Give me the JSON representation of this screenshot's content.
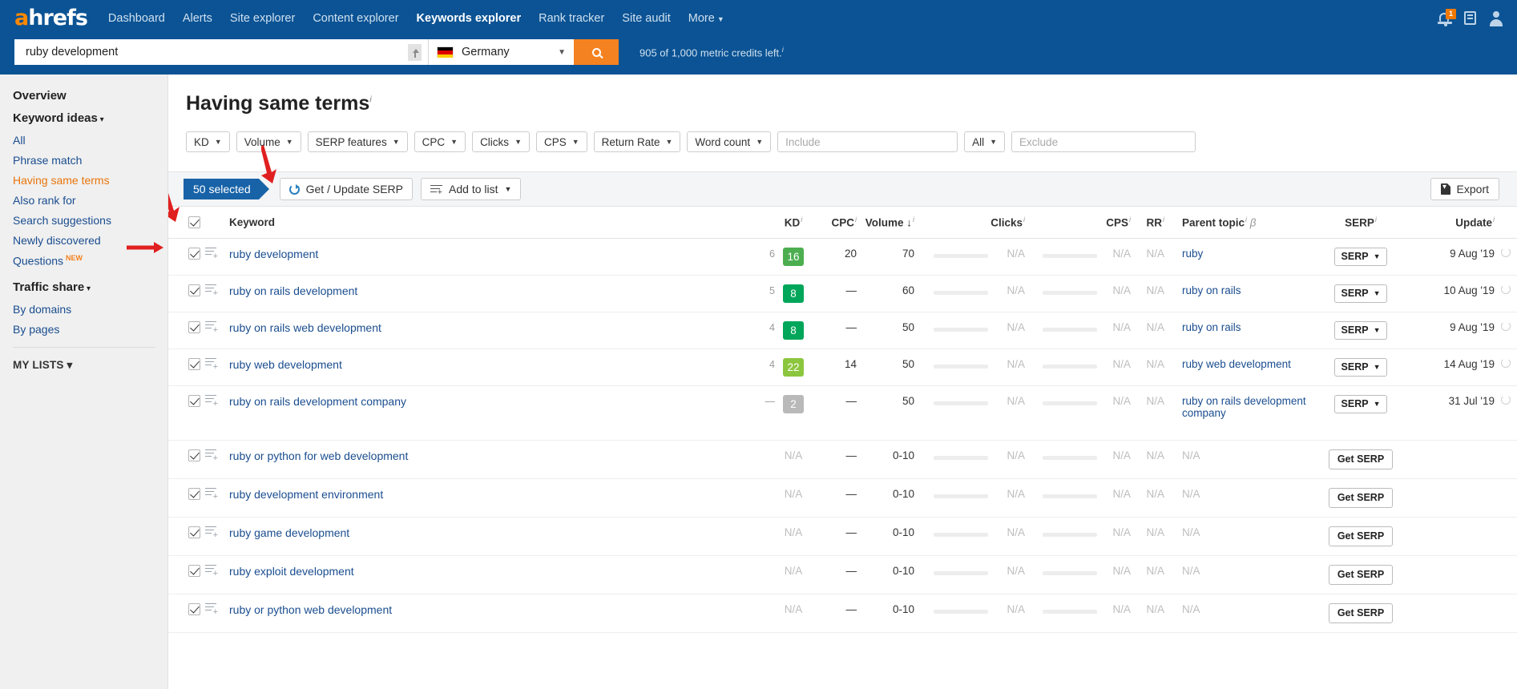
{
  "nav": {
    "logo": "ahrefs",
    "items": [
      {
        "label": "Dashboard",
        "active": false
      },
      {
        "label": "Alerts",
        "active": false
      },
      {
        "label": "Site explorer",
        "active": false
      },
      {
        "label": "Content explorer",
        "active": false
      },
      {
        "label": "Keywords explorer",
        "active": true
      },
      {
        "label": "Rank tracker",
        "active": false
      },
      {
        "label": "Site audit",
        "active": false
      },
      {
        "label": "More",
        "active": false,
        "caret": true
      }
    ],
    "notification_count": "1"
  },
  "search": {
    "value": "ruby development",
    "country": "Germany",
    "credits": "905 of 1,000 metric credits left."
  },
  "sidebar": {
    "overview": "Overview",
    "keyword_ideas": "Keyword ideas",
    "keyword_ideas_items": [
      {
        "label": "All",
        "active": false
      },
      {
        "label": "Phrase match",
        "active": false
      },
      {
        "label": "Having same terms",
        "active": true
      },
      {
        "label": "Also rank for",
        "active": false
      },
      {
        "label": "Search suggestions",
        "active": false
      },
      {
        "label": "Newly discovered",
        "active": false
      },
      {
        "label": "Questions",
        "active": false,
        "badge": "NEW"
      }
    ],
    "traffic_share": "Traffic share",
    "traffic_share_items": [
      {
        "label": "By domains"
      },
      {
        "label": "By pages"
      }
    ],
    "my_lists": "MY LISTS"
  },
  "page": {
    "title": "Having same terms"
  },
  "filters": [
    {
      "label": "KD"
    },
    {
      "label": "Volume"
    },
    {
      "label": "SERP features"
    },
    {
      "label": "CPC"
    },
    {
      "label": "Clicks"
    },
    {
      "label": "CPS"
    },
    {
      "label": "Return Rate"
    },
    {
      "label": "Word count"
    }
  ],
  "include_placeholder": "Include",
  "include_value": "",
  "all_dropdown": "All",
  "exclude_placeholder": "Exclude",
  "exclude_value": "",
  "toolbar": {
    "selected": "50 selected",
    "get_update_serp": "Get / Update SERP",
    "add_to_list": "Add to list",
    "export": "Export"
  },
  "table": {
    "headers": {
      "keyword": "Keyword",
      "kd": "KD",
      "cpc": "CPC",
      "volume": "Volume",
      "clicks": "Clicks",
      "cps": "CPS",
      "rr": "RR",
      "parent_topic": "Parent topic",
      "serp": "SERP",
      "update": "Update"
    },
    "rows": [
      {
        "keyword": "ruby development",
        "sd": "6",
        "kd": "16",
        "kd_color": "#4cae4f",
        "cpc": "20",
        "volume": "70",
        "clicks": "N/A",
        "cps": "N/A",
        "rr": "N/A",
        "parent_topic": "ruby",
        "serp_btn": "SERP",
        "update": "9 Aug '19",
        "has_serp": true
      },
      {
        "keyword": "ruby on rails development",
        "sd": "5",
        "kd": "8",
        "kd_color": "#00a65a",
        "cpc": "—",
        "volume": "60",
        "clicks": "N/A",
        "cps": "N/A",
        "rr": "N/A",
        "parent_topic": "ruby on rails",
        "serp_btn": "SERP",
        "update": "10 Aug '19",
        "has_serp": true
      },
      {
        "keyword": "ruby on rails web development",
        "sd": "4",
        "kd": "8",
        "kd_color": "#00a65a",
        "cpc": "—",
        "volume": "50",
        "clicks": "N/A",
        "cps": "N/A",
        "rr": "N/A",
        "parent_topic": "ruby on rails",
        "serp_btn": "SERP",
        "update": "9 Aug '19",
        "has_serp": true
      },
      {
        "keyword": "ruby web development",
        "sd": "4",
        "kd": "22",
        "kd_color": "#8cc63e",
        "cpc": "14",
        "volume": "50",
        "clicks": "N/A",
        "cps": "N/A",
        "rr": "N/A",
        "parent_topic": "ruby web development",
        "serp_btn": "SERP",
        "update": "14 Aug '19",
        "has_serp": true
      },
      {
        "keyword": "ruby on rails development company",
        "sd": "—",
        "kd": "2",
        "kd_color": "#b9b9b9",
        "cpc": "—",
        "volume": "50",
        "clicks": "N/A",
        "cps": "N/A",
        "rr": "N/A",
        "parent_topic": "ruby on rails development company",
        "serp_btn": "SERP",
        "update": "31 Jul '19",
        "has_serp": true,
        "tall": true
      },
      {
        "keyword": "ruby or python for web development",
        "sd": "",
        "kd": "N/A",
        "kd_color": "",
        "cpc": "—",
        "volume": "0-10",
        "clicks": "N/A",
        "cps": "N/A",
        "rr": "N/A",
        "parent_topic": "N/A",
        "serp_btn": "Get SERP",
        "update": "",
        "has_serp": false
      },
      {
        "keyword": "ruby development environment",
        "sd": "",
        "kd": "N/A",
        "kd_color": "",
        "cpc": "—",
        "volume": "0-10",
        "clicks": "N/A",
        "cps": "N/A",
        "rr": "N/A",
        "parent_topic": "N/A",
        "serp_btn": "Get SERP",
        "update": "",
        "has_serp": false
      },
      {
        "keyword": "ruby game development",
        "sd": "",
        "kd": "N/A",
        "kd_color": "",
        "cpc": "—",
        "volume": "0-10",
        "clicks": "N/A",
        "cps": "N/A",
        "rr": "N/A",
        "parent_topic": "N/A",
        "serp_btn": "Get SERP",
        "update": "",
        "has_serp": false
      },
      {
        "keyword": "ruby exploit development",
        "sd": "",
        "kd": "N/A",
        "kd_color": "",
        "cpc": "—",
        "volume": "0-10",
        "clicks": "N/A",
        "cps": "N/A",
        "rr": "N/A",
        "parent_topic": "N/A",
        "serp_btn": "Get SERP",
        "update": "",
        "has_serp": false
      },
      {
        "keyword": "ruby or python web development",
        "sd": "",
        "kd": "N/A",
        "kd_color": "",
        "cpc": "—",
        "volume": "0-10",
        "clicks": "N/A",
        "cps": "N/A",
        "rr": "N/A",
        "parent_topic": "N/A",
        "serp_btn": "Get SERP",
        "update": "",
        "has_serp": false
      }
    ]
  },
  "colors": {
    "brand_blue": "#0b5394",
    "brand_orange": "#f58220",
    "link_blue": "#1a4d8f",
    "annotation_red": "#e02020"
  }
}
